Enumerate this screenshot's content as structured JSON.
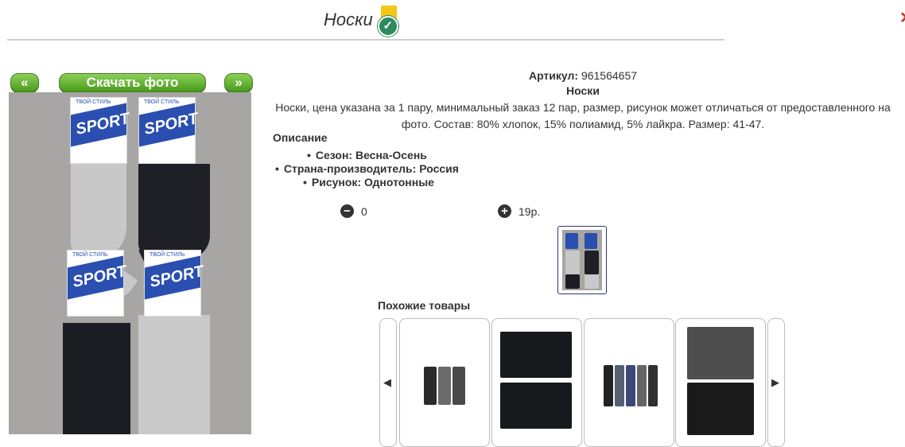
{
  "header": {
    "title": "Носки",
    "corner_icon": "close-icon"
  },
  "gallery": {
    "prev_label": "«",
    "download_label": "Скачать фото",
    "next_label": "»",
    "card_text": "SPORT",
    "card_small": "ТВОЙ СТИЛЬ"
  },
  "product": {
    "article_label": "Артикул:",
    "article_value": "961564657",
    "name": "Носки",
    "description": "Носки, цена указана за 1 пару, минимальный заказ 12 пар, размер, рисунок может отличаться от предоставленного на фото. Состав: 80% хлопок, 15% полиамид, 5% лайкра. Размер: 41-47.",
    "desc_heading": "Описание",
    "features": [
      "Сезон: Весна-Осень",
      "Страна-производитель: Россия",
      "Рисунок: Однотонные"
    ]
  },
  "order": {
    "quantity": "0",
    "price": "19р."
  },
  "similar": {
    "heading": "Похожие товары"
  },
  "colors": {
    "button_green": "#5aa826",
    "card_blue": "#2a4fb0",
    "badge_green": "#2d8a5f"
  }
}
